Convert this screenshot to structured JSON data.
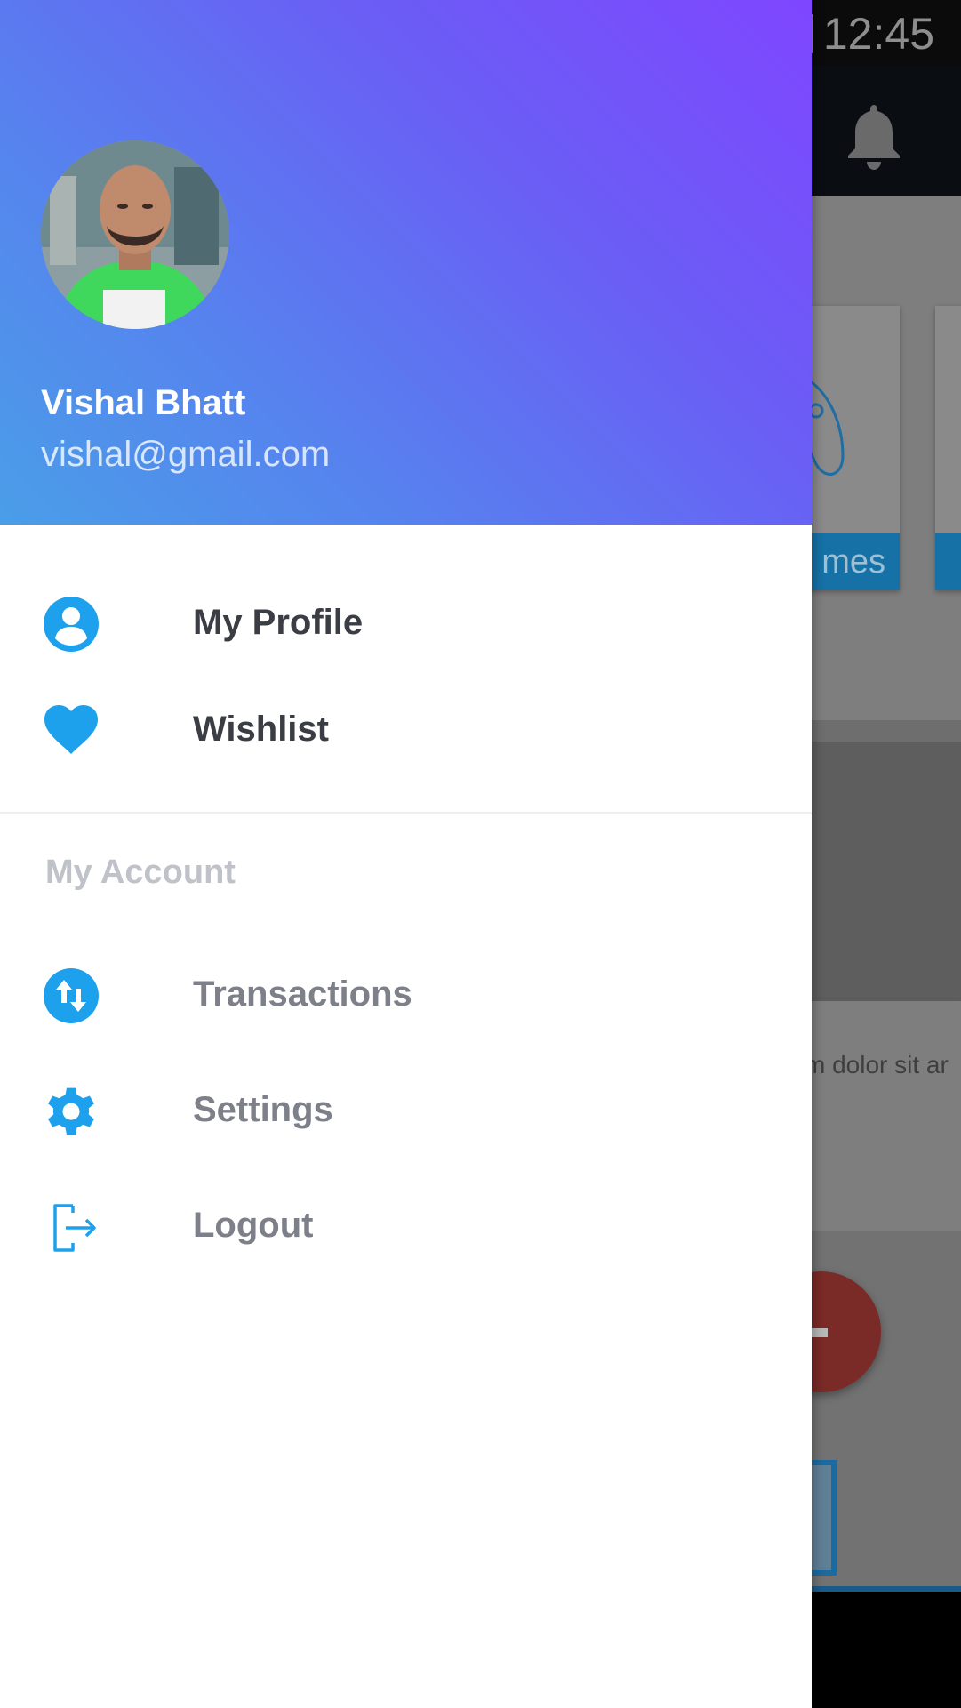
{
  "status_bar": {
    "time": "12:45"
  },
  "background_app": {
    "card_label_partial": "mes",
    "text_snippet": "m dolor sit ar"
  },
  "drawer": {
    "user": {
      "name": "Vishal Bhatt",
      "email": "vishal@gmail.com"
    },
    "primary_items": [
      {
        "label": "My Profile",
        "icon": "account-circle-icon"
      },
      {
        "label": "Wishlist",
        "icon": "heart-icon"
      }
    ],
    "section_title": "My Account",
    "account_items": [
      {
        "label": "Transactions",
        "icon": "transactions-icon"
      },
      {
        "label": "Settings",
        "icon": "gear-icon"
      },
      {
        "label": "Logout",
        "icon": "logout-icon"
      }
    ]
  },
  "colors": {
    "accent": "#1ea1ec",
    "header_gradient_start": "#4a9ee8",
    "header_gradient_end": "#7f46ff",
    "primary_text": "#3a3d44",
    "secondary_text": "#7e8089",
    "section_title": "#bfc2c8"
  }
}
